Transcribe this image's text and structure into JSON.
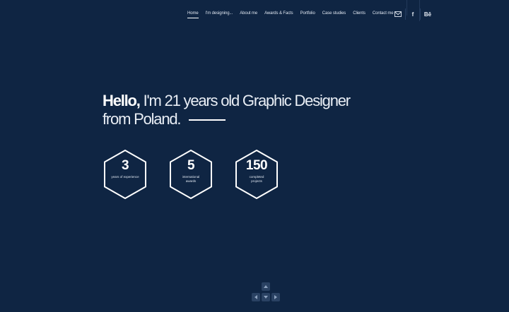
{
  "nav": {
    "items": [
      {
        "label": "Home",
        "active": true
      },
      {
        "label": "I'm designing...",
        "active": false
      },
      {
        "label": "About me",
        "active": false
      },
      {
        "label": "Awards & Facts",
        "active": false
      },
      {
        "label": "Portfolio",
        "active": false
      },
      {
        "label": "Case studies",
        "active": false
      },
      {
        "label": "Clients",
        "active": false
      },
      {
        "label": "Contact me",
        "active": false
      }
    ]
  },
  "social": {
    "icons": [
      "mail-icon",
      "facebook-icon",
      "behance-icon"
    ],
    "facebook_glyph": "f",
    "behance_glyph": "Bē"
  },
  "hero": {
    "greeting": "Hello,",
    "line1_rest": " I'm 21 years old Graphic Designer",
    "line2": "from Poland."
  },
  "stats": [
    {
      "value": "3",
      "label": "years of experience"
    },
    {
      "value": "5",
      "label": "international awards"
    },
    {
      "value": "150",
      "label": "completed projects"
    }
  ],
  "colors": {
    "background": "#0f2543",
    "text": "#ffffff",
    "key": "#2a4263"
  }
}
